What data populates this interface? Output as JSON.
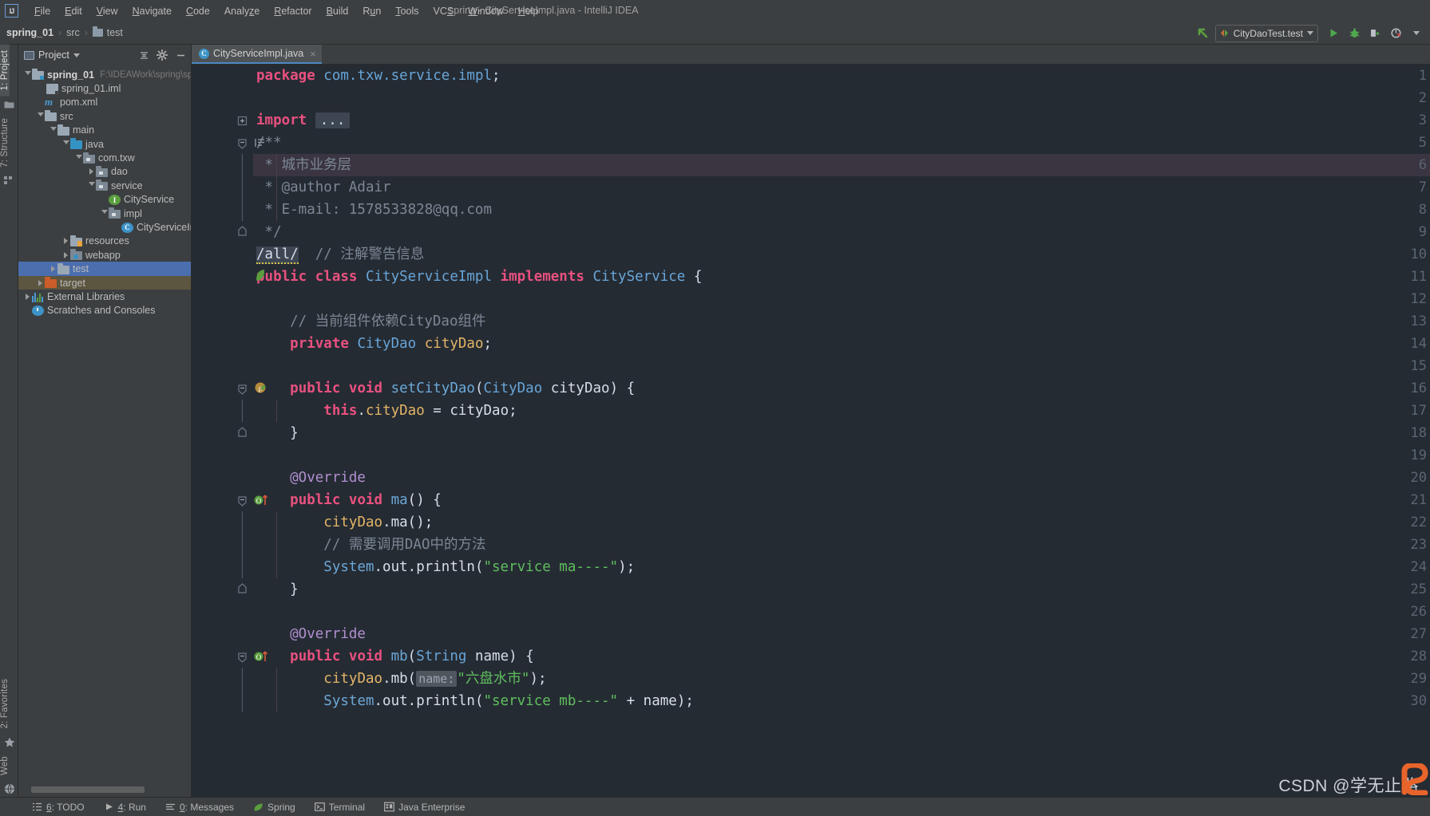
{
  "window": {
    "title": "spring - CityServiceImpl.java - IntelliJ IDEA",
    "logo": "IJ"
  },
  "menubar": {
    "items": [
      {
        "label": "File",
        "mnemonic": "F"
      },
      {
        "label": "Edit",
        "mnemonic": "E"
      },
      {
        "label": "View",
        "mnemonic": "V"
      },
      {
        "label": "Navigate",
        "mnemonic": "N"
      },
      {
        "label": "Code",
        "mnemonic": "C"
      },
      {
        "label": "Analyze",
        "mnemonic": "z"
      },
      {
        "label": "Refactor",
        "mnemonic": "R"
      },
      {
        "label": "Build",
        "mnemonic": "B"
      },
      {
        "label": "Run",
        "mnemonic": "u"
      },
      {
        "label": "Tools",
        "mnemonic": "T"
      },
      {
        "label": "VCS",
        "mnemonic": "S"
      },
      {
        "label": "Window",
        "mnemonic": "W"
      },
      {
        "label": "Help",
        "mnemonic": "H"
      }
    ]
  },
  "navbar": {
    "breadcrumb": [
      {
        "label": "spring_01",
        "bold": true,
        "folder": false
      },
      {
        "label": "src",
        "bold": false,
        "folder": false
      },
      {
        "label": "test",
        "bold": false,
        "folder": true
      }
    ],
    "run_config": "CityDaoTest.test",
    "buttons": {
      "back_to_editor": "back-arrow-icon",
      "run": "run-icon",
      "debug": "debug-icon",
      "run_with_coverage": "coverage-icon",
      "profiler": "profiler-icon"
    }
  },
  "left_stripe": {
    "top": [
      {
        "label": "1: Project",
        "mnemonic": "1",
        "active": true
      },
      {
        "label": "",
        "icon": "folder-icon"
      },
      {
        "label": "7: Structure",
        "mnemonic": "7",
        "active": false
      },
      {
        "label": "",
        "icon": "structure-icon"
      }
    ],
    "bottom": [
      {
        "label": "2: Favorites",
        "mnemonic": "2"
      },
      {
        "label": "",
        "icon": "star-icon"
      },
      {
        "label": "Web",
        "mnemonic": ""
      },
      {
        "label": "",
        "icon": "globe-icon"
      }
    ]
  },
  "project_panel": {
    "title": "Project",
    "buttons": [
      "collapse-all-icon",
      "settings-gear-icon",
      "hide-icon"
    ],
    "tree": [
      {
        "indent": 0,
        "arrow": "open",
        "icon": "module-folder",
        "label": "spring_01",
        "bold": true,
        "path": "F:\\IDEAWork\\spring\\spring",
        "selected": "none"
      },
      {
        "indent": 1,
        "arrow": "none",
        "icon": "iml",
        "label": "spring_01.iml",
        "bold": false,
        "path": "",
        "selected": "none"
      },
      {
        "indent": 1,
        "arrow": "none",
        "icon": "maven",
        "label": "pom.xml",
        "bold": false,
        "path": "",
        "selected": "none"
      },
      {
        "indent": 1,
        "arrow": "open",
        "icon": "folder",
        "label": "src",
        "bold": false,
        "path": "",
        "selected": "none"
      },
      {
        "indent": 2,
        "arrow": "open",
        "icon": "folder",
        "label": "main",
        "bold": false,
        "path": "",
        "selected": "none"
      },
      {
        "indent": 3,
        "arrow": "open",
        "icon": "folder-blue",
        "label": "java",
        "bold": false,
        "path": "",
        "selected": "none"
      },
      {
        "indent": 4,
        "arrow": "open",
        "icon": "package",
        "label": "com.txw",
        "bold": false,
        "path": "",
        "selected": "none"
      },
      {
        "indent": 5,
        "arrow": "closed",
        "icon": "package",
        "label": "dao",
        "bold": false,
        "path": "",
        "selected": "none"
      },
      {
        "indent": 5,
        "arrow": "open",
        "icon": "package",
        "label": "service",
        "bold": false,
        "path": "",
        "selected": "none"
      },
      {
        "indent": 6,
        "arrow": "none",
        "icon": "interface",
        "label": "CityService",
        "bold": false,
        "path": "",
        "selected": "none"
      },
      {
        "indent": 6,
        "arrow": "open",
        "icon": "package",
        "label": "impl",
        "bold": false,
        "path": "",
        "selected": "none"
      },
      {
        "indent": 7,
        "arrow": "none",
        "icon": "class",
        "label": "CityServiceImpl",
        "bold": false,
        "path": "",
        "selected": "none"
      },
      {
        "indent": 3,
        "arrow": "closed",
        "icon": "resources",
        "label": "resources",
        "bold": false,
        "path": "",
        "selected": "none"
      },
      {
        "indent": 3,
        "arrow": "closed",
        "icon": "webapp",
        "label": "webapp",
        "bold": false,
        "path": "",
        "selected": "none"
      },
      {
        "indent": 2,
        "arrow": "closed",
        "icon": "folder",
        "label": "test",
        "bold": false,
        "path": "",
        "selected": "blue"
      },
      {
        "indent": 1,
        "arrow": "closed",
        "icon": "folder-orange",
        "label": "target",
        "bold": false,
        "path": "",
        "selected": "olive"
      },
      {
        "indent": 0,
        "arrow": "closed",
        "icon": "libraries",
        "label": "External Libraries",
        "bold": false,
        "path": "",
        "selected": "none"
      },
      {
        "indent": 0,
        "arrow": "none",
        "icon": "scratch",
        "label": "Scratches and Consoles",
        "bold": false,
        "path": "",
        "selected": "none"
      }
    ]
  },
  "editor": {
    "tab": {
      "label": "CityServiceImpl.java",
      "icon": "java-class-icon",
      "close": "×"
    },
    "lines": [
      {
        "num": "1",
        "gutter": "",
        "fold": "",
        "highlight": false,
        "tokens": [
          {
            "t": "package ",
            "c": "kw"
          },
          {
            "t": "com.txw.service.impl",
            "c": "pkgname"
          },
          {
            "t": ";",
            "c": "pln"
          }
        ]
      },
      {
        "num": "2",
        "gutter": "",
        "fold": "",
        "highlight": false,
        "tokens": []
      },
      {
        "num": "3",
        "gutter": "",
        "fold": "plus",
        "highlight": false,
        "tokens": [
          {
            "t": "import ",
            "c": "kw"
          },
          {
            "t": "...",
            "c": "dots"
          }
        ]
      },
      {
        "num": "5",
        "gutter": "docmark",
        "fold": "start",
        "highlight": false,
        "tokens": [
          {
            "t": "/**",
            "c": "cmt"
          }
        ]
      },
      {
        "num": "6",
        "gutter": "",
        "fold": "bar",
        "highlight": true,
        "tokens": [
          {
            "t": " * 城市业务层",
            "c": "cmt"
          }
        ]
      },
      {
        "num": "7",
        "gutter": "",
        "fold": "bar",
        "highlight": false,
        "tokens": [
          {
            "t": " * @author Adair",
            "c": "cmt"
          }
        ]
      },
      {
        "num": "8",
        "gutter": "",
        "fold": "bar",
        "highlight": false,
        "tokens": [
          {
            "t": " * E-mail: 1578533828@qq.com",
            "c": "cmt"
          }
        ]
      },
      {
        "num": "9",
        "gutter": "",
        "fold": "end",
        "highlight": false,
        "tokens": [
          {
            "t": " */",
            "c": "cmt"
          }
        ]
      },
      {
        "num": "10",
        "gutter": "",
        "fold": "",
        "highlight": false,
        "tokens": [
          {
            "t": "/all/",
            "c": "warn"
          },
          {
            "t": "  ",
            "c": "pln"
          },
          {
            "t": "// 注解警告信息",
            "c": "cmt"
          }
        ]
      },
      {
        "num": "11",
        "gutter": "spring",
        "fold": "",
        "highlight": false,
        "tokens": [
          {
            "t": "public class ",
            "c": "kw"
          },
          {
            "t": "CityServiceImpl ",
            "c": "typ"
          },
          {
            "t": "implements ",
            "c": "kw"
          },
          {
            "t": "CityService ",
            "c": "typ"
          },
          {
            "t": "{",
            "c": "pln"
          }
        ]
      },
      {
        "num": "12",
        "gutter": "",
        "fold": "",
        "highlight": false,
        "tokens": []
      },
      {
        "num": "13",
        "gutter": "",
        "fold": "",
        "highlight": false,
        "tokens": [
          {
            "t": "    // 当前组件依赖CityDao组件",
            "c": "cmt"
          }
        ]
      },
      {
        "num": "14",
        "gutter": "",
        "fold": "",
        "highlight": false,
        "tokens": [
          {
            "t": "    ",
            "c": "pln"
          },
          {
            "t": "private ",
            "c": "kw"
          },
          {
            "t": "CityDao ",
            "c": "typ"
          },
          {
            "t": "cityDao",
            "c": "fld"
          },
          {
            "t": ";",
            "c": "pln"
          }
        ]
      },
      {
        "num": "15",
        "gutter": "",
        "fold": "",
        "highlight": false,
        "tokens": []
      },
      {
        "num": "16",
        "gutter": "bean",
        "fold": "start",
        "highlight": false,
        "tokens": [
          {
            "t": "    ",
            "c": "pln"
          },
          {
            "t": "public void ",
            "c": "kw"
          },
          {
            "t": "setCityDao",
            "c": "mth"
          },
          {
            "t": "(",
            "c": "pln"
          },
          {
            "t": "CityDao ",
            "c": "typ"
          },
          {
            "t": "cityDao",
            "c": "pln"
          },
          {
            "t": ") {",
            "c": "pln"
          }
        ]
      },
      {
        "num": "17",
        "gutter": "",
        "fold": "bar",
        "highlight": false,
        "tokens": [
          {
            "t": "        ",
            "c": "pln"
          },
          {
            "t": "this",
            "c": "kw"
          },
          {
            "t": ".",
            "c": "pln"
          },
          {
            "t": "cityDao",
            "c": "fld"
          },
          {
            "t": " = cityDao;",
            "c": "pln"
          }
        ]
      },
      {
        "num": "18",
        "gutter": "",
        "fold": "end",
        "highlight": false,
        "tokens": [
          {
            "t": "    }",
            "c": "pln"
          }
        ]
      },
      {
        "num": "19",
        "gutter": "",
        "fold": "",
        "highlight": false,
        "tokens": []
      },
      {
        "num": "20",
        "gutter": "",
        "fold": "",
        "highlight": false,
        "tokens": [
          {
            "t": "    @Override",
            "c": "ann"
          }
        ]
      },
      {
        "num": "21",
        "gutter": "override",
        "fold": "start",
        "highlight": false,
        "tokens": [
          {
            "t": "    ",
            "c": "pln"
          },
          {
            "t": "public void ",
            "c": "kw"
          },
          {
            "t": "ma",
            "c": "mth"
          },
          {
            "t": "() {",
            "c": "pln"
          }
        ]
      },
      {
        "num": "22",
        "gutter": "",
        "fold": "bar",
        "highlight": false,
        "tokens": [
          {
            "t": "        ",
            "c": "pln"
          },
          {
            "t": "cityDao",
            "c": "fld"
          },
          {
            "t": ".ma();",
            "c": "pln"
          }
        ]
      },
      {
        "num": "23",
        "gutter": "",
        "fold": "bar",
        "highlight": false,
        "tokens": [
          {
            "t": "        // 需要调用DAO中的方法",
            "c": "cmt"
          }
        ]
      },
      {
        "num": "24",
        "gutter": "",
        "fold": "bar",
        "highlight": false,
        "tokens": [
          {
            "t": "        ",
            "c": "pln"
          },
          {
            "t": "System",
            "c": "mth"
          },
          {
            "t": ".out.println(",
            "c": "pln"
          },
          {
            "t": "\"service ma----\"",
            "c": "str"
          },
          {
            "t": ");",
            "c": "pln"
          }
        ]
      },
      {
        "num": "25",
        "gutter": "",
        "fold": "end",
        "highlight": false,
        "tokens": [
          {
            "t": "    }",
            "c": "pln"
          }
        ]
      },
      {
        "num": "26",
        "gutter": "",
        "fold": "",
        "highlight": false,
        "tokens": []
      },
      {
        "num": "27",
        "gutter": "",
        "fold": "",
        "highlight": false,
        "tokens": [
          {
            "t": "    @Override",
            "c": "ann"
          }
        ]
      },
      {
        "num": "28",
        "gutter": "override",
        "fold": "start",
        "highlight": false,
        "tokens": [
          {
            "t": "    ",
            "c": "pln"
          },
          {
            "t": "public void ",
            "c": "kw"
          },
          {
            "t": "mb",
            "c": "mth"
          },
          {
            "t": "(",
            "c": "pln"
          },
          {
            "t": "String ",
            "c": "typ"
          },
          {
            "t": "name",
            "c": "pln"
          },
          {
            "t": ") {",
            "c": "pln"
          }
        ]
      },
      {
        "num": "29",
        "gutter": "",
        "fold": "bar",
        "highlight": false,
        "tokens": [
          {
            "t": "        ",
            "c": "pln"
          },
          {
            "t": "cityDao",
            "c": "fld"
          },
          {
            "t": ".mb(",
            "c": "pln"
          },
          {
            "t": "name:",
            "c": "hint"
          },
          {
            "t": "\"六盘水市\"",
            "c": "str"
          },
          {
            "t": ");",
            "c": "pln"
          }
        ]
      },
      {
        "num": "30",
        "gutter": "",
        "fold": "bar",
        "highlight": false,
        "tokens": [
          {
            "t": "        ",
            "c": "pln"
          },
          {
            "t": "System",
            "c": "mth"
          },
          {
            "t": ".out.println(",
            "c": "pln"
          },
          {
            "t": "\"service mb----\"",
            "c": "str"
          },
          {
            "t": " + name);",
            "c": "pln"
          }
        ]
      }
    ]
  },
  "statusbar": {
    "items": [
      {
        "label": "6: TODO",
        "mnemonic": "6",
        "icon": "todo-icon"
      },
      {
        "label": "4: Run",
        "mnemonic": "4",
        "icon": "run-icon"
      },
      {
        "label": "0: Messages",
        "mnemonic": "0",
        "icon": "messages-icon"
      },
      {
        "label": "Spring",
        "mnemonic": "",
        "icon": "spring-leaf-icon"
      },
      {
        "label": "Terminal",
        "mnemonic": "",
        "icon": "terminal-icon"
      },
      {
        "label": "Java Enterprise",
        "mnemonic": "",
        "icon": "javaee-icon"
      }
    ]
  },
  "watermark": {
    "text": "CSDN @学无止路"
  },
  "colors": {
    "accent": "#4b6eaf",
    "editor_bg": "#252b33",
    "panel_bg": "#3c3f41",
    "keyword": "#e8517f",
    "type": "#67a5d8",
    "string": "#5fbf5f",
    "comment": "#7b8794",
    "field": "#e3b567",
    "annotation": "#b08fd0",
    "selection": "#4b6eaf",
    "highlight_line": "#3b3541"
  }
}
